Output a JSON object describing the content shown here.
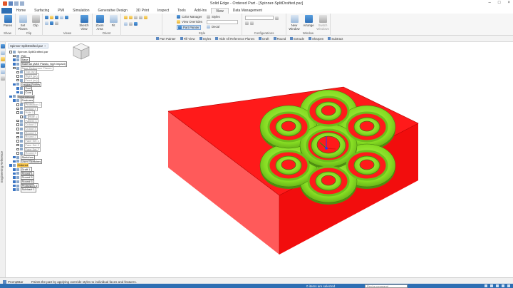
{
  "window": {
    "title": "Solid Edge - Ordered Part - [Spinner-SplitDrafted.par]"
  },
  "tabs": [
    {
      "label": "Home"
    },
    {
      "label": "Surfacing"
    },
    {
      "label": "PMI"
    },
    {
      "label": "Simulation"
    },
    {
      "label": "Generative Design"
    },
    {
      "label": "3D Print"
    },
    {
      "label": "Inspect"
    },
    {
      "label": "Tools"
    },
    {
      "label": "Add-Ins"
    },
    {
      "label": "View"
    },
    {
      "label": "Data Management"
    }
  ],
  "ribbon": {
    "show_group": {
      "label": "Show",
      "btn": "Panes"
    },
    "clip_group": {
      "label": "Clip",
      "btn1": "Set Planes",
      "btn2": "Clip"
    },
    "views_group": {
      "label": "Views",
      "btn": "Sketch View"
    },
    "orient_group": {
      "label": "Orient",
      "btn1": "Zoom Area",
      "btn2": "Fit"
    },
    "style_group": {
      "label": "Style",
      "color_manager": "Color Manager",
      "view_overrides": "View Overrides",
      "part_painter": "Part Painter",
      "styles": "Styles",
      "decal": "Decal"
    },
    "config_group": {
      "label": "Configurations"
    },
    "window_group": {
      "label": "Window",
      "new_window": "New Window",
      "arrange": "Arrange",
      "switch": "Switch Windows"
    }
  },
  "command_bar": [
    {
      "label": "Part Painter"
    },
    {
      "label": "Fill View"
    },
    {
      "label": "Styles"
    },
    {
      "label": "Hide All Reference Planes"
    },
    {
      "label": "Draft"
    },
    {
      "label": "Round"
    },
    {
      "label": "Extrude"
    },
    {
      "label": "Sharpen"
    },
    {
      "label": "Subtract"
    }
  ],
  "left_panel": {
    "vertical_label": "Engineering Reference"
  },
  "pathfinder": {
    "doc_tab": "Spinner-SplitDrafted.par",
    "items": [
      {
        "label": "Spinner-SplitDrafted.par",
        "cls": "",
        "indent": 0
      },
      {
        "label": "PMI",
        "cls": "",
        "indent": 1
      },
      {
        "label": "Base",
        "cls": "boxed",
        "indent": 1
      },
      {
        "label": "Material (ABS Plastic, high impact)",
        "cls": "boxed",
        "indent": 1
      },
      {
        "label": "Base Reference Planes",
        "cls": "muted",
        "indent": 1
      },
      {
        "label": "Top (xy)",
        "cls": "muted",
        "indent": 2
      },
      {
        "label": "Right (yz)",
        "cls": "muted",
        "indent": 2
      },
      {
        "label": "Front (xz)",
        "cls": "muted",
        "indent": 2
      },
      {
        "label": "Design Bodies",
        "cls": "boxed",
        "indent": 1
      },
      {
        "label": "Tool",
        "cls": "boxed",
        "indent": 2
      },
      {
        "label": "Core",
        "cls": "boxed",
        "indent": 2
      },
      {
        "label": "Synchronous",
        "cls": "group-hdr",
        "indent": 0
      },
      {
        "label": "Features",
        "cls": "boxed",
        "indent": 1
      },
      {
        "label": "Protrusion 1",
        "cls": "muted",
        "indent": 2
      },
      {
        "label": "Cutout 1",
        "cls": "muted",
        "indent": 2
      },
      {
        "label": "Hole 1",
        "cls": "muted",
        "indent": 2
      },
      {
        "label": "Hole 1",
        "cls": "muted",
        "indent": 3
      },
      {
        "label": "Pattern 1",
        "cls": "muted",
        "indent": 2
      },
      {
        "label": "Cutout 2",
        "cls": "muted",
        "indent": 2
      },
      {
        "label": "Cutout 3",
        "cls": "muted",
        "indent": 2
      },
      {
        "label": "Round 1",
        "cls": "muted",
        "indent": 2
      },
      {
        "label": "Round 2",
        "cls": "muted",
        "indent": 2
      },
      {
        "label": "Face Set 1",
        "cls": "muted",
        "indent": 2
      },
      {
        "label": "Face Set 2",
        "cls": "muted",
        "indent": 2
      },
      {
        "label": "Face Set 3",
        "cls": "muted",
        "indent": 2
      },
      {
        "label": "Round 3",
        "cls": "muted",
        "indent": 2
      },
      {
        "label": "Sketches",
        "cls": "boxed",
        "indent": 1
      },
      {
        "label": "Used Sketches",
        "cls": "boxed",
        "indent": 1
      },
      {
        "label": "Ordered",
        "cls": "ordered",
        "indent": 0
      },
      {
        "label": "Draft 1",
        "cls": "boxed",
        "indent": 1
      },
      {
        "label": "Round 4",
        "cls": "boxed",
        "indent": 1
      },
      {
        "label": "Round 5",
        "cls": "boxed",
        "indent": 1
      },
      {
        "label": "Round 6",
        "cls": "boxed",
        "indent": 1
      },
      {
        "label": "Protrusion 4",
        "cls": "boxed",
        "indent": 1
      },
      {
        "label": "Subtract 1",
        "cls": "boxed",
        "indent": 1
      }
    ]
  },
  "colors": {
    "block_top": "#ff1a1a",
    "block_front": "#ff5a5a",
    "block_side": "#f20d0d",
    "core": "#8ee62a",
    "core_dark": "#4f8f10",
    "accent": "#2e6fb3"
  },
  "status": {
    "prompt_label": "PromptBar",
    "message": "Paints the part by applying override styles to individual faces and features.",
    "selection": "0 items are selected",
    "find_placeholder": "Find a command"
  }
}
